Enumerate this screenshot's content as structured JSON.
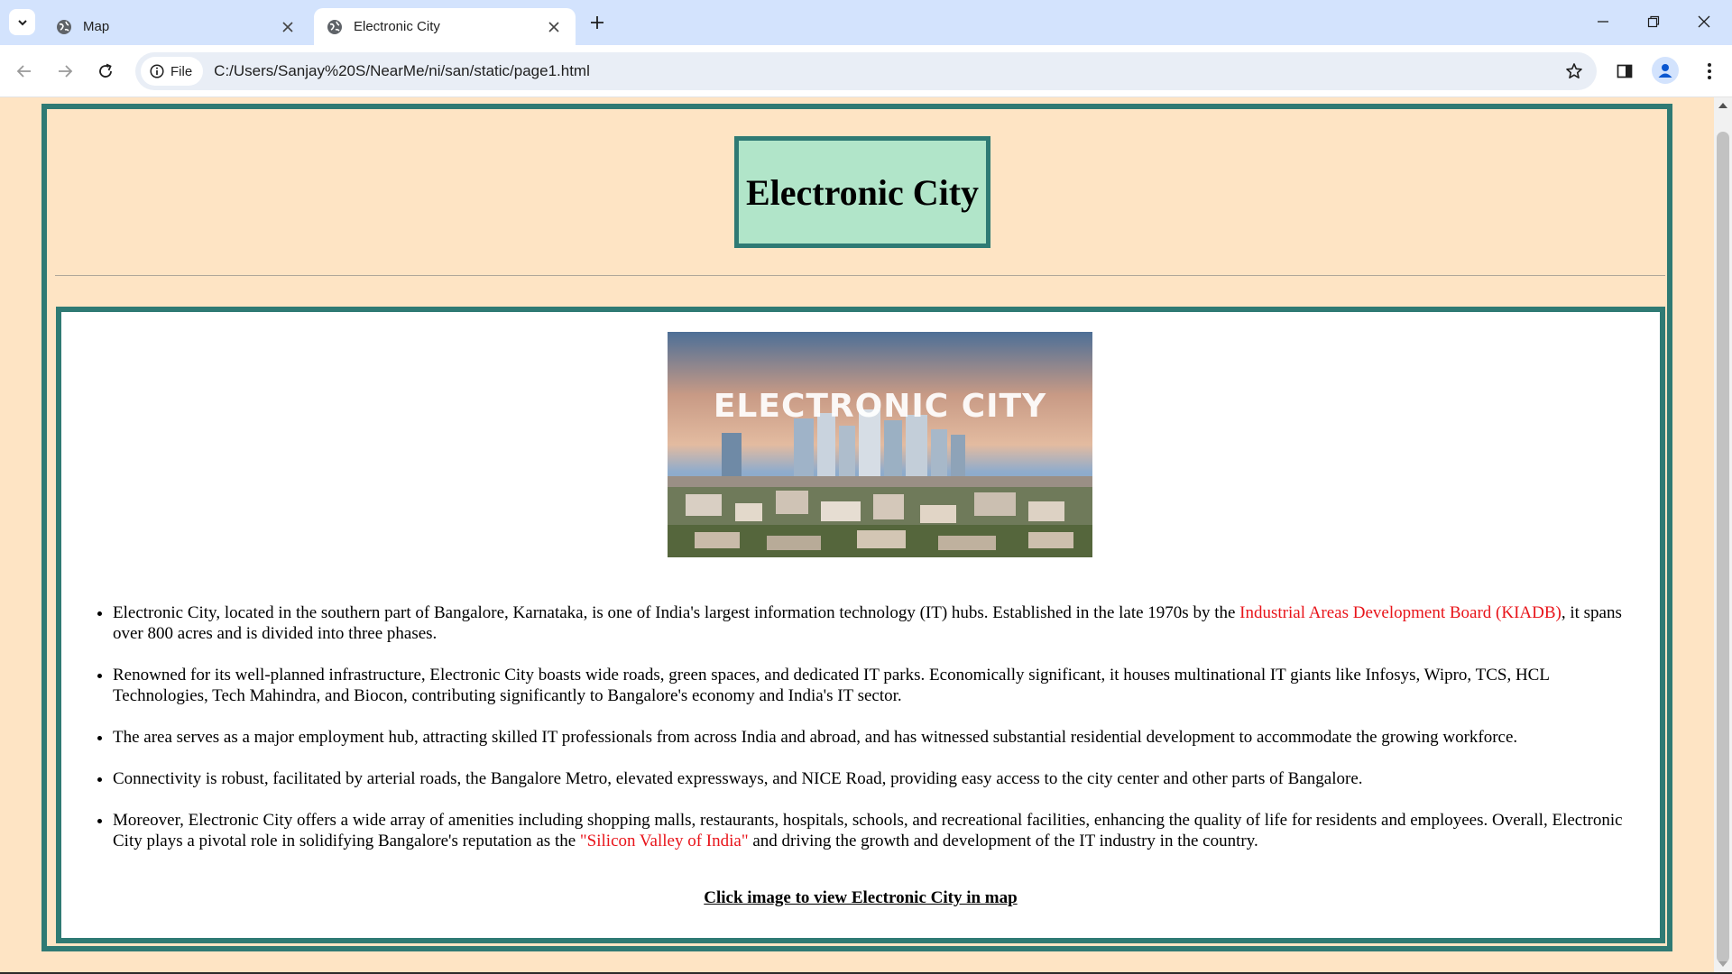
{
  "browser": {
    "tabs": [
      {
        "title": "Map",
        "active": false
      },
      {
        "title": "Electronic City",
        "active": true
      }
    ],
    "site_chip": "File",
    "url": "C:/Users/Sanjay%20S/NearMe/ni/san/static/page1.html"
  },
  "page": {
    "title": "Electronic City",
    "image_caption": "ELECTRONIC CITY",
    "bullets": [
      {
        "before": "Electronic City, located in the southern part of Bangalore, Karnataka, is one of India's largest information technology (IT) hubs. Established in the late 1970s by the ",
        "highlight": "Industrial Areas Development Board (KIADB)",
        "after": ", it spans over 800 acres and is divided into three phases."
      },
      {
        "before": "Renowned for its well-planned infrastructure, Electronic City boasts wide roads, green spaces, and dedicated IT parks. Economically significant, it houses multinational IT giants like Infosys, Wipro, TCS, HCL Technologies, Tech Mahindra, and Biocon, contributing significantly to Bangalore's economy and India's IT sector.",
        "highlight": "",
        "after": ""
      },
      {
        "before": "The area serves as a major employment hub, attracting skilled IT professionals from across India and abroad, and has witnessed substantial residential development to accommodate the growing workforce.",
        "highlight": "",
        "after": ""
      },
      {
        "before": "Connectivity is robust, facilitated by arterial roads, the Bangalore Metro, elevated expressways, and NICE Road, providing easy access to the city center and other parts of Bangalore.",
        "highlight": "",
        "after": ""
      },
      {
        "before": "Moreover, Electronic City offers a wide array of amenities including shopping malls, restaurants, hospitals, schools, and recreational facilities, enhancing the quality of life for residents and employees. Overall, Electronic City plays a pivotal role in solidifying Bangalore's reputation as the ",
        "highlight": "\"Silicon Valley of India\"",
        "after": " and driving the growth and development of the IT industry in the country."
      }
    ],
    "map_link": "Click image to view Electronic City in map"
  },
  "colors": {
    "page_background": "#fee4c4",
    "frame_border": "#2f7a74",
    "title_box_fill": "#b1e5c9",
    "highlight_text": "#e8141a",
    "tabbar": "#d3e3fd"
  }
}
